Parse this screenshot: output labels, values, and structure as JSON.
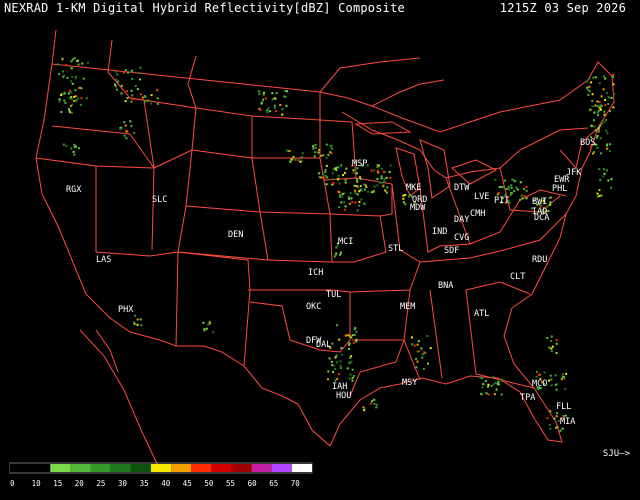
{
  "header": {
    "title": "NEXRAD 1-KM Digital Hybrid Reflectivity[dBZ] Composite",
    "timestamp": "1215Z 03 Sep 2026"
  },
  "offmap_label": "SJU—>",
  "stations": [
    {
      "id": "RGX"
    },
    {
      "id": "SLC"
    },
    {
      "id": "DEN"
    },
    {
      "id": "LAS"
    },
    {
      "id": "PHX"
    },
    {
      "id": "MSP"
    },
    {
      "id": "MKE"
    },
    {
      "id": "ORD"
    },
    {
      "id": "MDW"
    },
    {
      "id": "DTW"
    },
    {
      "id": "LVE"
    },
    {
      "id": "PIT"
    },
    {
      "id": "CMH"
    },
    {
      "id": "DAY"
    },
    {
      "id": "CVG"
    },
    {
      "id": "IND"
    },
    {
      "id": "SDF"
    },
    {
      "id": "STL"
    },
    {
      "id": "MCI"
    },
    {
      "id": "ICH"
    },
    {
      "id": "OKC"
    },
    {
      "id": "TUL"
    },
    {
      "id": "DFW"
    },
    {
      "id": "DAL"
    },
    {
      "id": "IAH"
    },
    {
      "id": "HOU"
    },
    {
      "id": "MSY"
    },
    {
      "id": "MEM"
    },
    {
      "id": "BNA"
    },
    {
      "id": "ATL"
    },
    {
      "id": "CLT"
    },
    {
      "id": "RDU"
    },
    {
      "id": "BWI"
    },
    {
      "id": "IAD"
    },
    {
      "id": "DCA"
    },
    {
      "id": "PHL"
    },
    {
      "id": "EWR"
    },
    {
      "id": "JFK"
    },
    {
      "id": "BOS"
    },
    {
      "id": "MCO"
    },
    {
      "id": "TPA"
    },
    {
      "id": "FLL"
    },
    {
      "id": "MIA"
    }
  ],
  "legend": {
    "ticks": [
      "0",
      "10",
      "15",
      "20",
      "25",
      "30",
      "35",
      "40",
      "45",
      "50",
      "55",
      "60",
      "65",
      "70"
    ],
    "colors": [
      "#000000",
      "#000000",
      "#7cd94a",
      "#52b83a",
      "#2f9a2a",
      "#1f7a1f",
      "#0d520d",
      "#f5e600",
      "#f2a000",
      "#ff2a00",
      "#d40000",
      "#a00000",
      "#c41fa0",
      "#b048ff",
      "#ffffff"
    ]
  },
  "colors": {
    "boundary": "#ff4a40",
    "background": "#000000",
    "text": "#ffffff"
  }
}
